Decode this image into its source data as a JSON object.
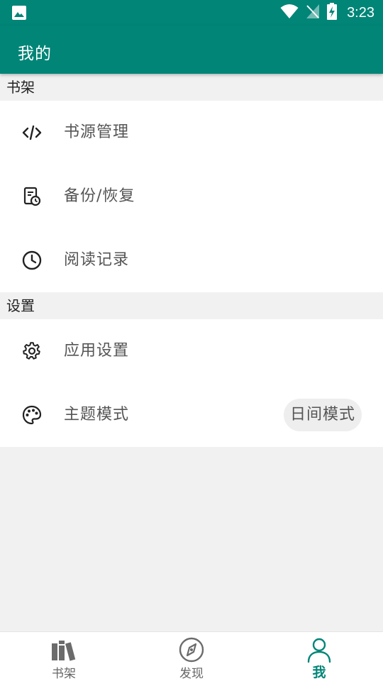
{
  "status_bar": {
    "time": "3:23",
    "icons": [
      "gallery-icon",
      "wifi-icon",
      "no-signal-icon",
      "battery-charging-icon"
    ]
  },
  "app_bar": {
    "title": "我的"
  },
  "sections": {
    "bookshelf": {
      "header": "书架",
      "items": [
        {
          "label": "书源管理",
          "icon": "code-icon"
        },
        {
          "label": "备份/恢复",
          "icon": "backup-restore-icon"
        },
        {
          "label": "阅读记录",
          "icon": "clock-icon"
        }
      ]
    },
    "settings": {
      "header": "设置",
      "items": [
        {
          "label": "应用设置",
          "icon": "gear-icon"
        },
        {
          "label": "主题模式",
          "icon": "palette-icon",
          "value": "日间模式"
        }
      ]
    }
  },
  "bottom_nav": {
    "items": [
      {
        "label": "书架",
        "icon": "books-icon"
      },
      {
        "label": "发现",
        "icon": "compass-icon"
      },
      {
        "label": "我",
        "icon": "person-icon",
        "active": true
      }
    ]
  },
  "colors": {
    "primary": "#008577",
    "background": "#f1f1f1",
    "surface": "#ffffff"
  }
}
